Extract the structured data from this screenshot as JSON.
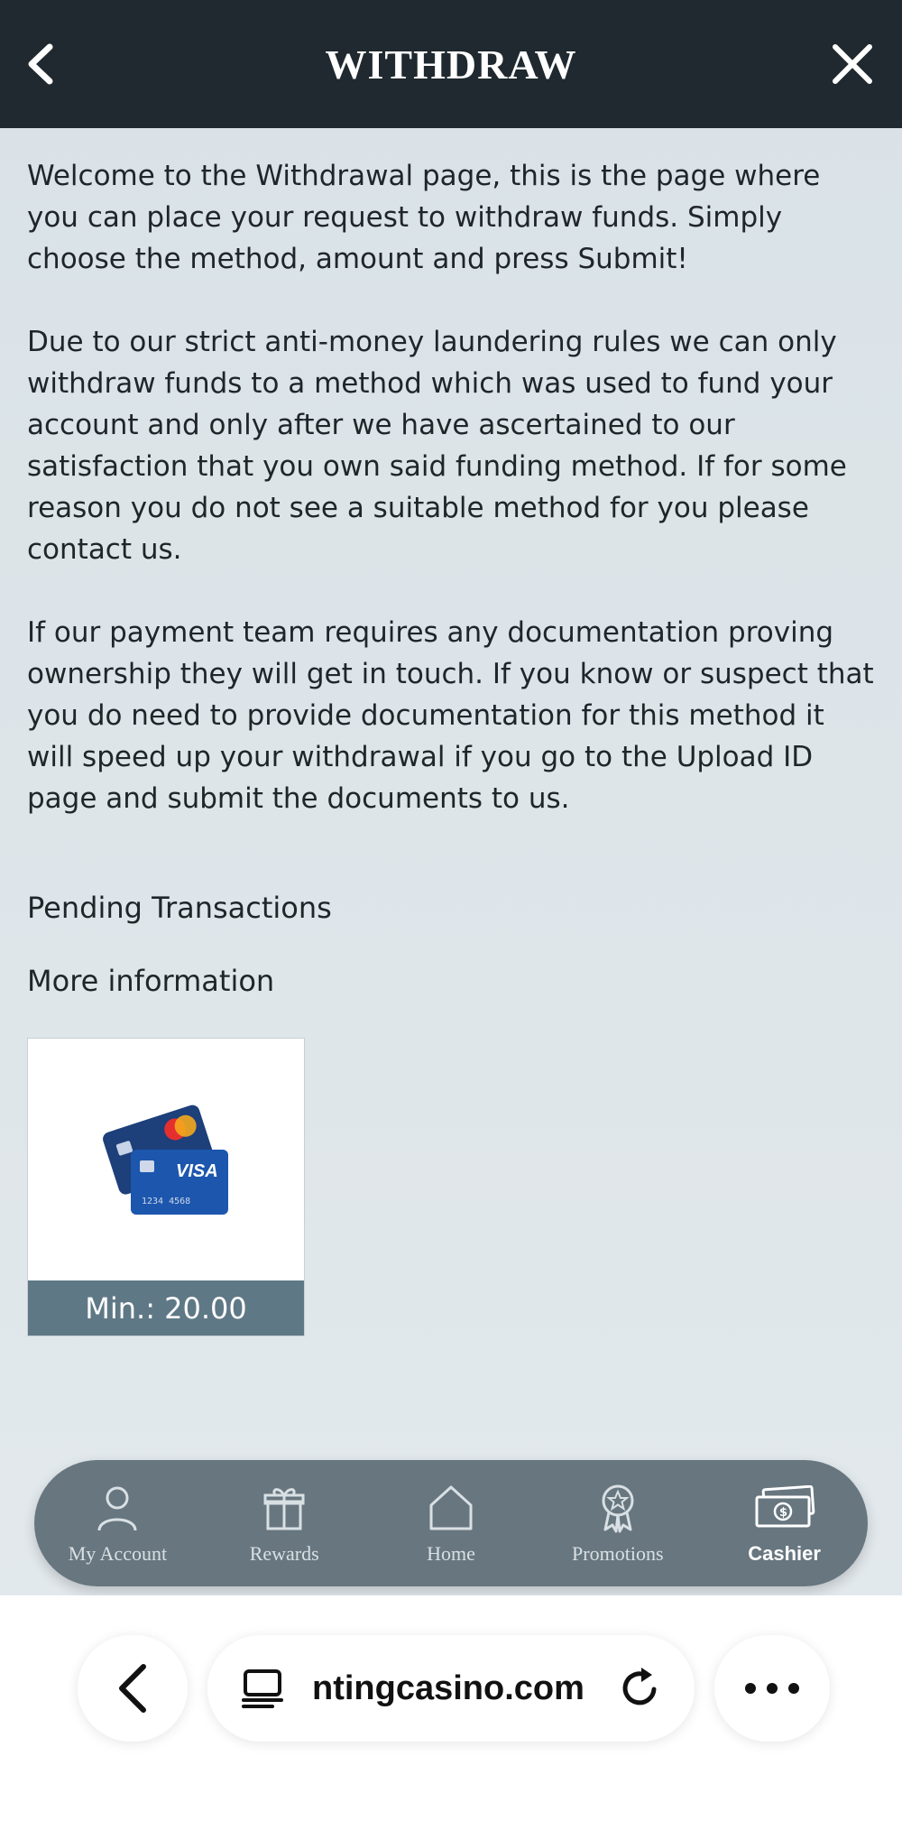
{
  "header": {
    "title": "WITHDRAW"
  },
  "content": {
    "paragraphs": [
      "Welcome to the Withdrawal page, this is the page where you can place your request to withdraw funds. Simply choose the method, amount and press Submit!",
      "Due to our strict anti-money laundering rules we can only withdraw funds to a method which was used to fund your account and only after we have ascertained to our satisfaction that you own said funding method. If for some reason you do not see a suitable method for you please contact us.",
      "If our payment team requires any documentation proving ownership they will get in touch. If you know or suspect that you do need to provide documentation for this method it will speed up your withdrawal if you go to the Upload ID page and submit the documents to us."
    ],
    "pending_link": "Pending Transactions",
    "more_info_link": "More information"
  },
  "method": {
    "min_label": "Min.: 20.00",
    "card_number_text": "1234 4568",
    "visa_text": "VISA"
  },
  "tabs": [
    {
      "label": "My Account",
      "icon": "user-icon"
    },
    {
      "label": "Rewards",
      "icon": "gift-icon"
    },
    {
      "label": "Home",
      "icon": "home-icon"
    },
    {
      "label": "Promotions",
      "icon": "award-icon"
    },
    {
      "label": "Cashier",
      "icon": "cash-icon",
      "active": true
    }
  ],
  "browser": {
    "url": "ntingcasino.com"
  },
  "colors": {
    "header_bg": "#1f292f",
    "tabbar_bg": "#67767f",
    "min_bar": "#5f7886"
  }
}
